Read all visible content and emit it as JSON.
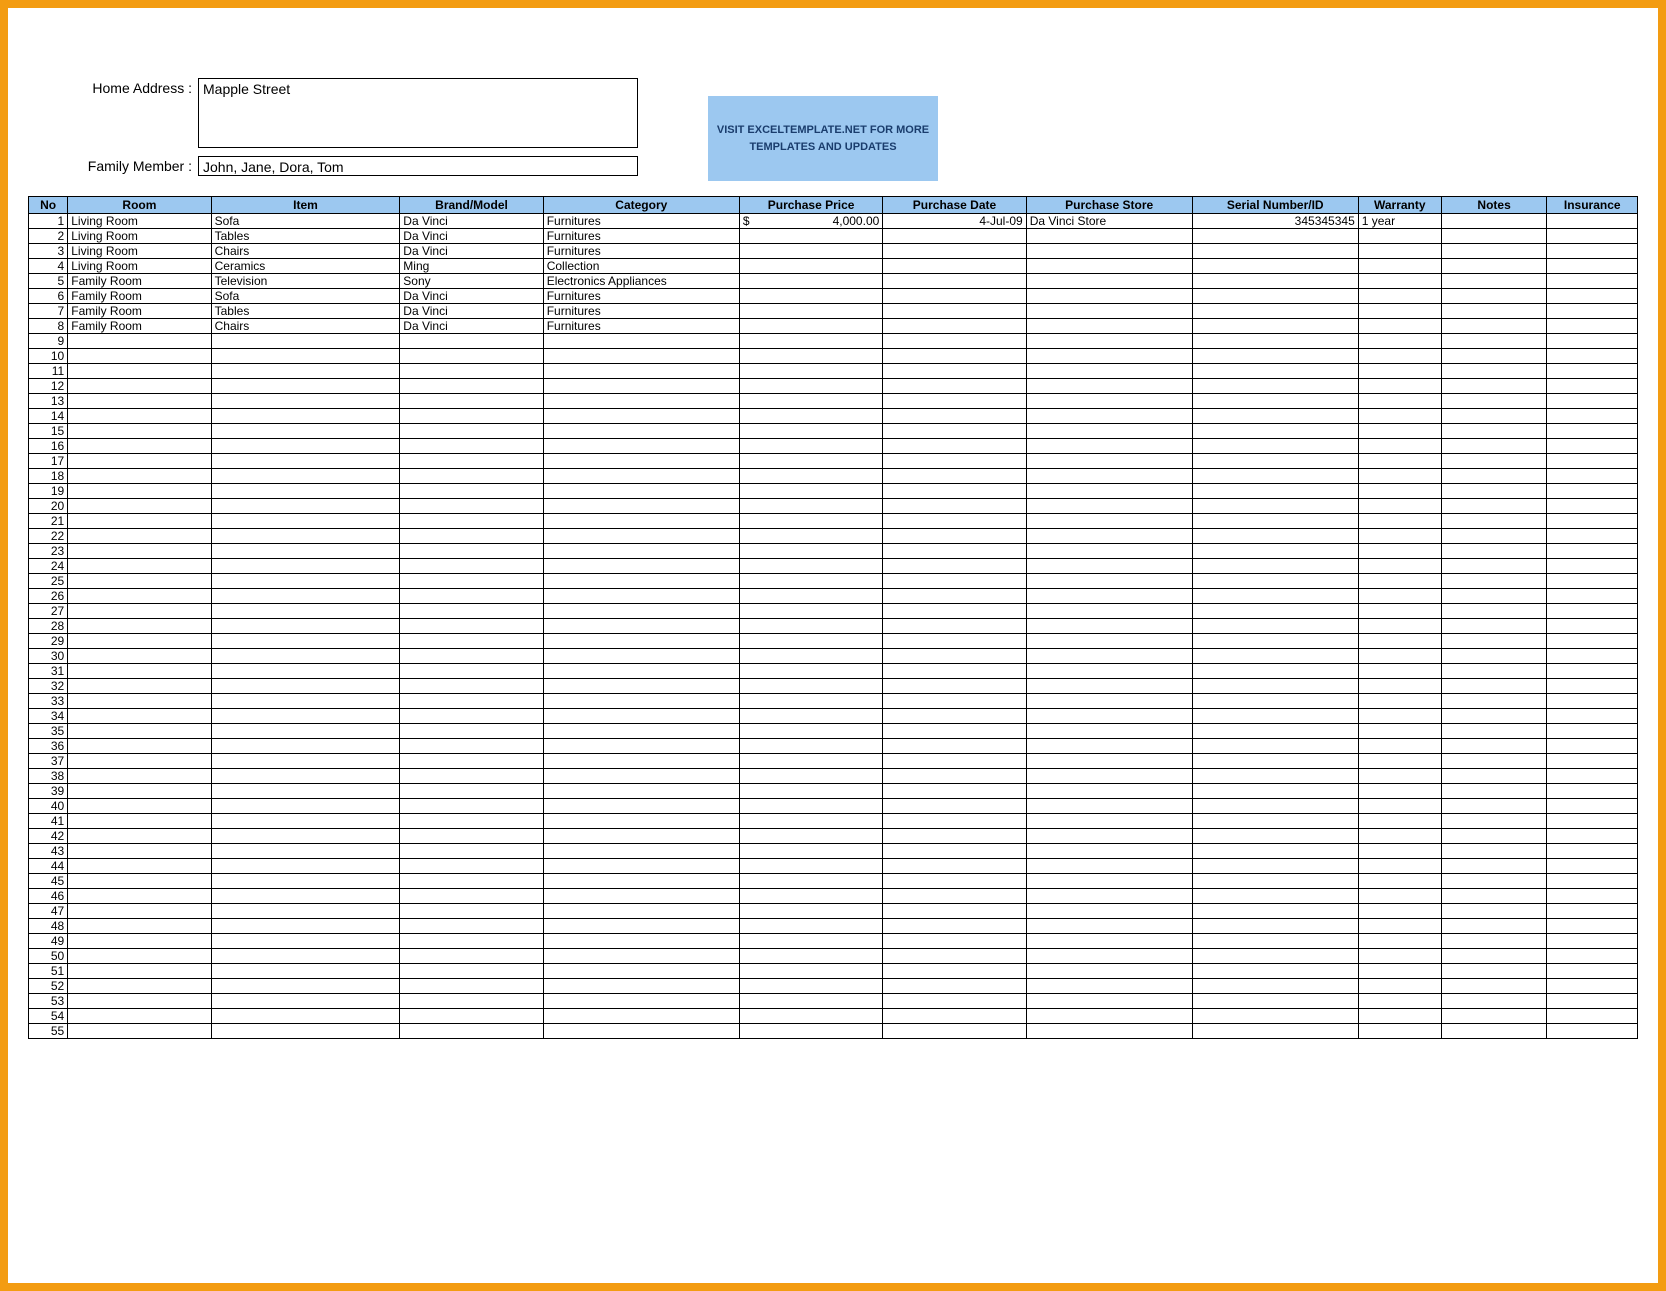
{
  "header": {
    "address_label": "Home Address :",
    "address_value": "Mapple Street",
    "family_label": "Family Member :",
    "family_value": "John, Jane, Dora, Tom"
  },
  "promo": {
    "text": "VISIT EXCELTEMPLATE.NET FOR MORE TEMPLATES AND UPDATES"
  },
  "table": {
    "columns": [
      "No",
      "Room",
      "Item",
      "Brand/Model",
      "Category",
      "Purchase Price",
      "Purchase Date",
      "Purchase Store",
      "Serial Number/ID",
      "Warranty",
      "Notes",
      "Insurance"
    ],
    "total_rows": 55,
    "rows": [
      {
        "no": "1",
        "room": "Living Room",
        "item": "Sofa",
        "brand": "Da Vinci",
        "category": "Furnitures",
        "price_sym": "$",
        "price_val": "4,000.00",
        "date": "4-Jul-09",
        "store": "Da Vinci Store",
        "serial": "345345345",
        "warranty": "1 year",
        "notes": "",
        "insurance": ""
      },
      {
        "no": "2",
        "room": "Living Room",
        "item": "Tables",
        "brand": "Da Vinci",
        "category": "Furnitures",
        "price_sym": "",
        "price_val": "",
        "date": "",
        "store": "",
        "serial": "",
        "warranty": "",
        "notes": "",
        "insurance": ""
      },
      {
        "no": "3",
        "room": "Living Room",
        "item": "Chairs",
        "brand": "Da Vinci",
        "category": "Furnitures",
        "price_sym": "",
        "price_val": "",
        "date": "",
        "store": "",
        "serial": "",
        "warranty": "",
        "notes": "",
        "insurance": ""
      },
      {
        "no": "4",
        "room": "Living Room",
        "item": "Ceramics",
        "brand": "Ming",
        "category": "Collection",
        "price_sym": "",
        "price_val": "",
        "date": "",
        "store": "",
        "serial": "",
        "warranty": "",
        "notes": "",
        "insurance": ""
      },
      {
        "no": "5",
        "room": "Family Room",
        "item": "Television",
        "brand": "Sony",
        "category": "Electronics Appliances",
        "price_sym": "",
        "price_val": "",
        "date": "",
        "store": "",
        "serial": "",
        "warranty": "",
        "notes": "",
        "insurance": ""
      },
      {
        "no": "6",
        "room": "Family Room",
        "item": "Sofa",
        "brand": "Da Vinci",
        "category": "Furnitures",
        "price_sym": "",
        "price_val": "",
        "date": "",
        "store": "",
        "serial": "",
        "warranty": "",
        "notes": "",
        "insurance": ""
      },
      {
        "no": "7",
        "room": "Family Room",
        "item": "Tables",
        "brand": "Da Vinci",
        "category": "Furnitures",
        "price_sym": "",
        "price_val": "",
        "date": "",
        "store": "",
        "serial": "",
        "warranty": "",
        "notes": "",
        "insurance": ""
      },
      {
        "no": "8",
        "room": "Family Room",
        "item": "Chairs",
        "brand": "Da Vinci",
        "category": "Furnitures",
        "price_sym": "",
        "price_val": "",
        "date": "",
        "store": "",
        "serial": "",
        "warranty": "",
        "notes": "",
        "insurance": ""
      }
    ]
  }
}
